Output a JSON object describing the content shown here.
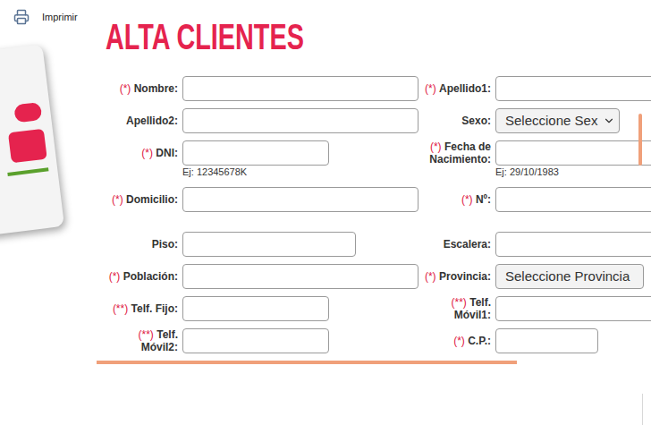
{
  "toolbar": {
    "print": "Imprimir"
  },
  "title": "ALTA CLIENTES",
  "form": {
    "rows": [
      {
        "left": {
          "marker": "(*)",
          "label": "Nombre:",
          "kind": "input"
        },
        "right": {
          "marker": "(*)",
          "label": "Apellido1:",
          "kind": "input"
        }
      },
      {
        "left": {
          "label": "Apellido2:",
          "kind": "input"
        },
        "right": {
          "label": "Sexo:",
          "kind": "select",
          "value": "Seleccione Sex"
        }
      },
      {
        "left": {
          "marker": "(*)",
          "label": "DNI:",
          "kind": "input",
          "hint": "Ej: 12345678K"
        },
        "right": {
          "marker": "(*)",
          "label": "Fecha de Nacimiento:",
          "kind": "input",
          "hint": "Ej: 29/10/1983"
        }
      },
      {
        "left": {
          "marker": "(*)",
          "label": "Domicilio:",
          "kind": "input"
        },
        "right": {
          "marker": "(*)",
          "label": "Nº:",
          "kind": "input"
        }
      },
      {
        "left": {
          "label": "Piso:",
          "kind": "input"
        },
        "right": {
          "label": "Escalera:",
          "kind": "input"
        }
      },
      {
        "left": {
          "marker": "(*)",
          "label": "Población:",
          "kind": "input"
        },
        "right": {
          "marker": "(*)",
          "label": "Provincia:",
          "kind": "select",
          "value": "Seleccione Provincia"
        }
      },
      {
        "left": {
          "marker": "(**)",
          "label": "Telf. Fijo:",
          "kind": "input"
        },
        "right": {
          "marker": "(**)",
          "label": "Telf. Móvil1:",
          "kind": "input"
        }
      },
      {
        "left": {
          "marker": "(**)",
          "label": "Telf. Móvil2:",
          "kind": "input"
        },
        "right": {
          "marker": "(*)",
          "label": "C.P.:",
          "kind": "input"
        }
      }
    ]
  }
}
